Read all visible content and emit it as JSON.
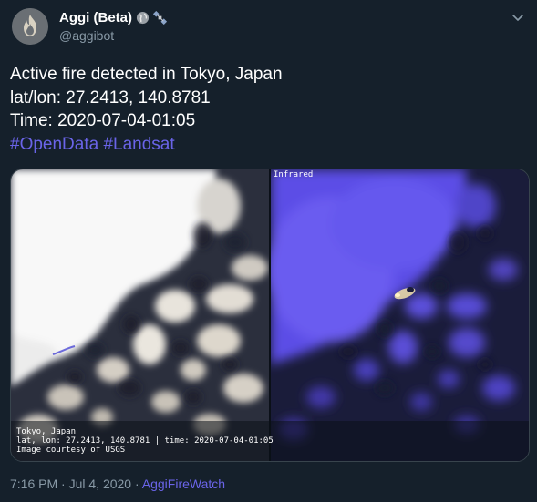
{
  "account": {
    "display_name": "Aggi (Beta)",
    "handle": "@aggibot",
    "name_emojis": [
      "globe-icon",
      "satellite-icon"
    ]
  },
  "tweet": {
    "lines": [
      "Active fire detected in Tokyo, Japan",
      "lat/lon: 27.2413, 140.8781",
      "Time: 2020-07-04-01:05"
    ],
    "hashtags": [
      "#OpenData",
      "#Landsat"
    ]
  },
  "media": {
    "panel_label": "Infrared",
    "caption": [
      "Tokyo, Japan",
      "lat, lon: 27.2413, 140.8781 | time: 2020-07-04-01:05",
      "Image courtesy of USGS"
    ]
  },
  "meta": {
    "time": "7:16 PM",
    "separator": " · ",
    "date": "Jul 4, 2020",
    "source": "AggiFireWatch"
  },
  "colors": {
    "background": "#15202b",
    "text": "#ffffff",
    "secondary_text": "#8899a6",
    "link": "#6a64e8",
    "border": "#38444d"
  }
}
